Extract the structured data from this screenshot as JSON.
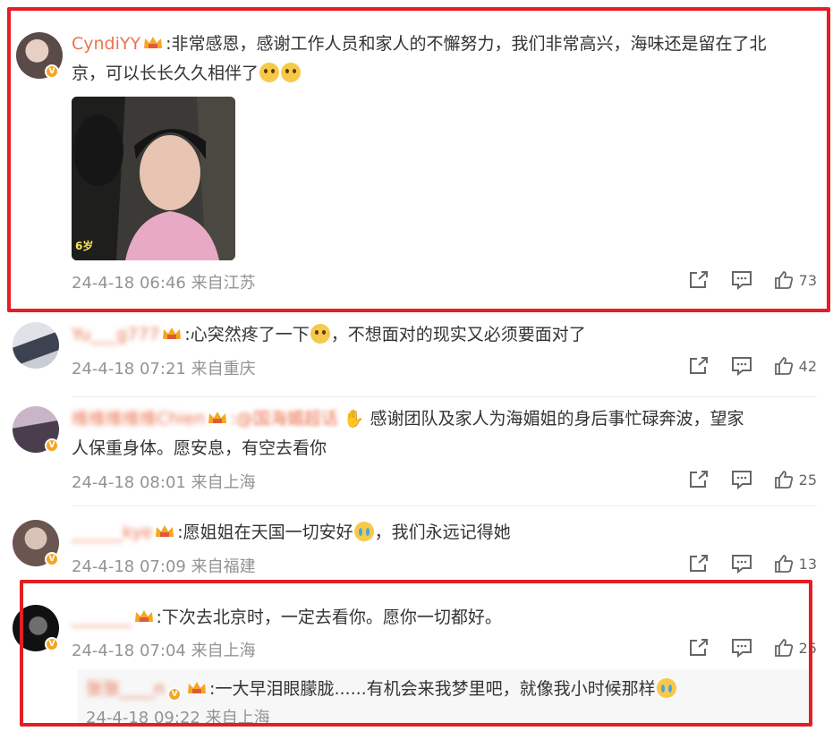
{
  "comments": [
    {
      "username": "CyndiYY",
      "text1": ":非常感恩，感谢工作人员和家人的不懈努力，我们非常高兴，海味还是留在了北",
      "text2": "京，可以长长久久相伴了",
      "image_badge": "6岁",
      "time": "24-4-18 06:46",
      "location": "来自江苏",
      "likes": "73"
    },
    {
      "username": "Yu___g777",
      "text": ":心突然疼了一下",
      "text_tail": "，不想面对的现实又必须要面对了",
      "time": "24-4-18 07:21",
      "location": "来自重庆",
      "likes": "42"
    },
    {
      "username": "维维维维维Chien",
      "mention": ":@国海媚超话",
      "text1": " 感谢团队及家人为海媚姐的身后事忙碌奔波，望家",
      "text2": "人保重身体。愿安息，有空去看你",
      "time": "24-4-18 08:01",
      "location": "来自上海",
      "likes": "25"
    },
    {
      "username": "______kye",
      "text": ":愿姐姐在天国一切安好",
      "text_tail": "，我们永远记得她",
      "time": "24-4-18 07:09",
      "location": "来自福建",
      "likes": "13"
    },
    {
      "username": "_______",
      "text": ":下次去北京时，一定去看你。愿你一切都好。",
      "time": "24-4-18 07:04",
      "location": "来自上海",
      "likes": "25"
    }
  ],
  "reply": {
    "username": "张张____n",
    "text": ":一大早泪眼朦胧......有机会来我梦里吧，就像我小时候那样",
    "time": "24-4-18 09:22",
    "location": "来自上海"
  },
  "icons": [
    "share-icon",
    "comment-icon",
    "like-icon",
    "crown-icon",
    "verified-icon"
  ],
  "colors": {
    "username": "#eb7350",
    "meta": "#939393",
    "highlight_box": "#e31e24"
  }
}
